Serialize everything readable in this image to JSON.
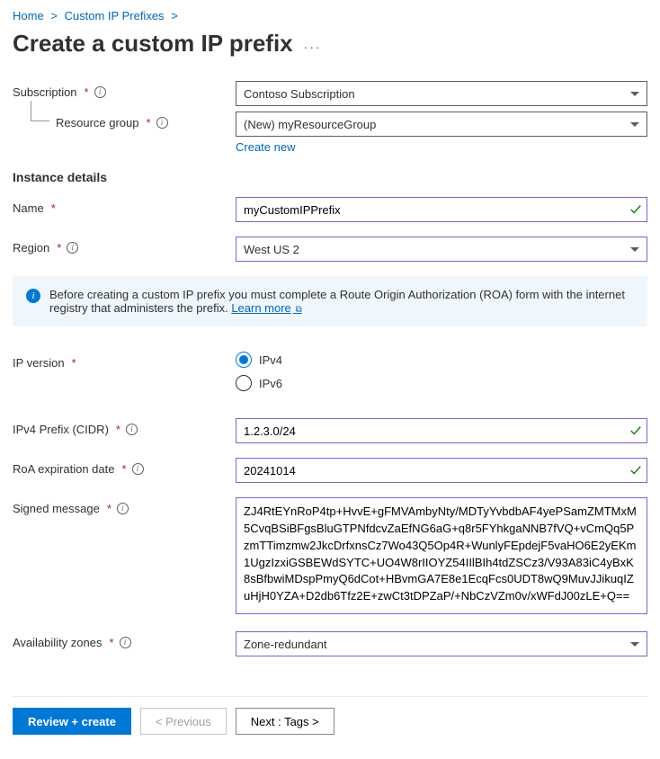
{
  "breadcrumb": {
    "home": "Home",
    "prefixes": "Custom IP Prefixes"
  },
  "page": {
    "title": "Create a custom IP prefix"
  },
  "labels": {
    "subscription": "Subscription",
    "resource_group": "Resource group",
    "create_new": "Create new",
    "instance_details": "Instance details",
    "name": "Name",
    "region": "Region",
    "ip_version": "IP version",
    "ipv4": "IPv4",
    "ipv6": "IPv6",
    "ipv4_prefix": "IPv4 Prefix (CIDR)",
    "roa_date": "RoA expiration date",
    "signed_message": "Signed message",
    "availability_zones": "Availability zones"
  },
  "values": {
    "subscription": "Contoso Subscription",
    "resource_group": "(New) myResourceGroup",
    "name": "myCustomIPPrefix",
    "region": "West US 2",
    "ipv4_prefix": "1.2.3.0/24",
    "roa_date": "20241014",
    "signed_message": "ZJ4RtEYnRoP4tp+HvvE+gFMVAmbyNty/MDTyYvbdbAF4yePSamZMTMxM5CvqBSiBFgsBluGTPNfdcvZaEfNG6aG+q8r5FYhkgaNNB7fVQ+vCmQq5PzmTTimzmw2JkcDrfxnsCz7Wo43Q5Op4R+WunlyFEpdejF5vaHO6E2yEKm1UgzIzxiGSBEWdSYTC+UO4W8rIIOYZ54IIlBIh4tdZSCz3/V93A83iC4yBxK8sBfbwiMDspPmyQ6dCot+HBvmGA7E8e1EcqFcs0UDT8wQ9MuvJJikuqIZuHjH0YZA+D2db6Tfz2E+zwCt3tDPZaP/+NbCzVZm0v/xWFdJ00zLE+Q==",
    "availability_zones": "Zone-redundant"
  },
  "info": {
    "text_a": "Before creating a custom IP prefix you must complete a Route Origin Authorization (ROA) form with the internet registry that administers the prefix. ",
    "learn_more": "Learn more"
  },
  "footer": {
    "review": "Review + create",
    "previous": "< Previous",
    "next": "Next : Tags >"
  }
}
